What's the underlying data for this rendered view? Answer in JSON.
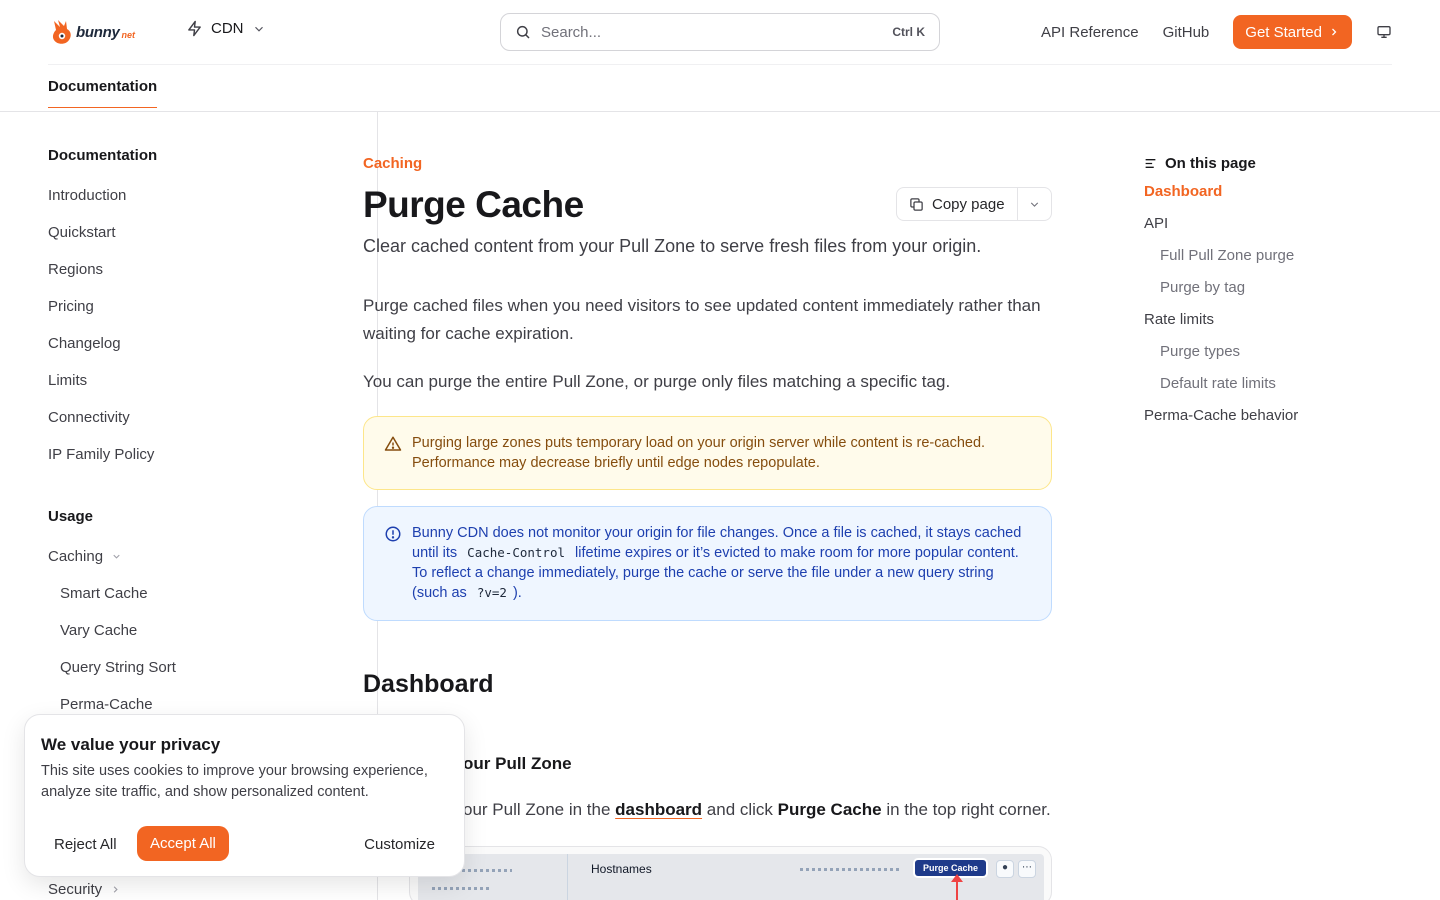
{
  "brand": {
    "name": "bunny",
    "suffix": "net",
    "accent": "#f26522"
  },
  "header": {
    "product": "CDN",
    "search_placeholder": "Search...",
    "search_shortcut": "Ctrl K",
    "links": {
      "api": "API Reference",
      "github": "GitHub"
    },
    "cta": "Get Started"
  },
  "tabs": {
    "documentation": "Documentation"
  },
  "sidebar": {
    "group1": "Documentation",
    "items1": [
      "Introduction",
      "Quickstart",
      "Regions",
      "Pricing",
      "Changelog",
      "Limits",
      "Connectivity",
      "IP Family Policy"
    ],
    "group2": "Usage",
    "caching": "Caching",
    "caching_items": [
      "Smart Cache",
      "Vary Cache",
      "Query String Sort",
      "Perma-Cache"
    ],
    "security": "Security"
  },
  "page": {
    "eyebrow": "Caching",
    "title": "Purge Cache",
    "copy_page": "Copy page",
    "subtitle": "Clear cached content from your Pull Zone to serve fresh files from your origin.",
    "para1": "Purge cached files when you need visitors to see updated content immediately rather than waiting for cache expiration.",
    "para2": "You can purge the entire Pull Zone, or purge only files matching a specific tag.",
    "warning": "Purging large zones puts temporary load on your origin server while content is re-cached. Performance may decrease briefly until edge nodes repopulate.",
    "info": {
      "t1": "Bunny CDN does not monitor your origin for file changes. Once a file is cached, it stays cached until its ",
      "code1": "Cache-Control",
      "t2": " lifetime expires or it’s evicted to make room for more popular content. To reflect a change immediately, purge the cache or serve the file under a new query string (such as ",
      "code2": "?v=2",
      "t3": ")."
    },
    "h2": "Dashboard",
    "step_title_visible": "our Pull Zone",
    "step_text": {
      "t1": "our Pull Zone in the ",
      "link": "dashboard",
      "t2": " and click ",
      "bold": "Purge Cache",
      "t3": " in the top right corner."
    },
    "screenshot": {
      "hostnames": "Hostnames",
      "purge_button": "Purge Cache"
    }
  },
  "toc": {
    "heading": "On this page",
    "items": [
      "Dashboard",
      "API",
      "Full Pull Zone purge",
      "Purge by tag",
      "Rate limits",
      "Purge types",
      "Default rate limits",
      "Perma-Cache behavior"
    ]
  },
  "cookie": {
    "title": "We value your privacy",
    "text": "This site uses cookies to improve your browsing experience, analyze site traffic, and show personalized content.",
    "reject": "Reject All",
    "accept": "Accept All",
    "customize": "Customize"
  }
}
